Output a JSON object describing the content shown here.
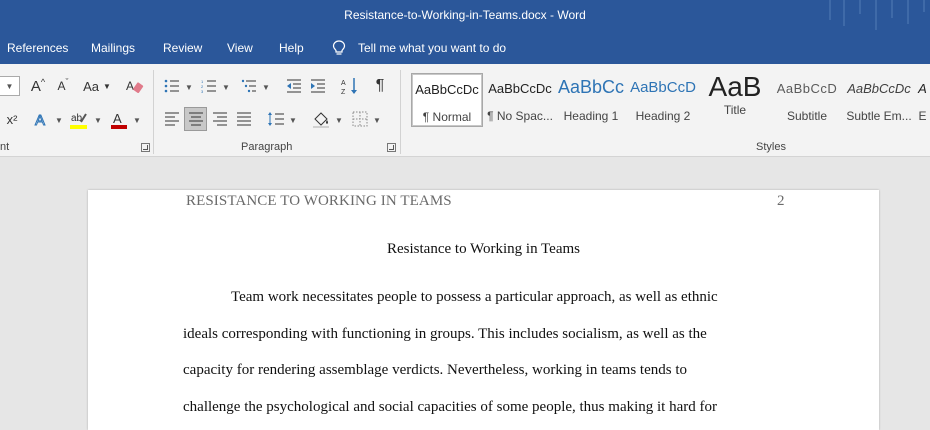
{
  "window": {
    "title": "Resistance-to-Working-in-Teams.docx  -  Word"
  },
  "menu": {
    "tabs": [
      "References",
      "Mailings",
      "Review",
      "View",
      "Help"
    ],
    "tell_me": "Tell me what you want to do"
  },
  "ribbon": {
    "groups": {
      "font_partial": "nt",
      "paragraph": "Paragraph",
      "styles": "Styles"
    },
    "font_buttons": {
      "case": "Aa",
      "grow": "A",
      "shrink": "A",
      "superscript": "x²"
    },
    "paragraph_buttons": {
      "pilcrow": "¶"
    },
    "styles": [
      {
        "sample": "AaBbCcDc",
        "name": "¶ Normal"
      },
      {
        "sample": "AaBbCcDc",
        "name": "¶ No Spac..."
      },
      {
        "sample": "AaBbCc",
        "name": "Heading 1"
      },
      {
        "sample": "AaBbCcD",
        "name": "Heading 2"
      },
      {
        "sample": "AaB",
        "name": "Title"
      },
      {
        "sample": "AaBbCcD",
        "name": "Subtitle"
      },
      {
        "sample": "AaBbCcDc",
        "name": "Subtle Em..."
      },
      {
        "sample": "A",
        "name": "E"
      }
    ],
    "colors": {
      "accent": "#2b579a",
      "heading": "#2e74b5",
      "font_color": "#c00000",
      "highlight": "#ffff00"
    }
  },
  "document": {
    "header": "RESISTANCE TO WORKING IN TEAMS",
    "page_number": "2",
    "title": "Resistance to Working in Teams",
    "lines": [
      "Team work necessitates people to possess a particular approach, as well as ethnic",
      "ideals corresponding with functioning in groups. This includes socialism, as well as the",
      "capacity for rendering assemblage verdicts. Nevertheless, working in teams tends to",
      "challenge the psychological and social capacities of some people, thus making it hard for"
    ]
  }
}
